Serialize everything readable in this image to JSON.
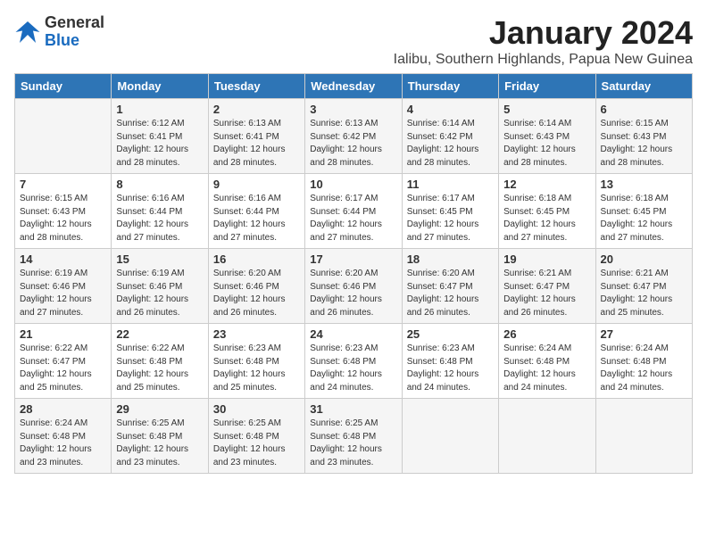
{
  "logo": {
    "general": "General",
    "blue": "Blue"
  },
  "title": "January 2024",
  "subtitle": "Ialibu, Southern Highlands, Papua New Guinea",
  "days": [
    "Sunday",
    "Monday",
    "Tuesday",
    "Wednesday",
    "Thursday",
    "Friday",
    "Saturday"
  ],
  "weeks": [
    [
      {
        "num": "",
        "info": ""
      },
      {
        "num": "1",
        "info": "Sunrise: 6:12 AM\nSunset: 6:41 PM\nDaylight: 12 hours\nand 28 minutes."
      },
      {
        "num": "2",
        "info": "Sunrise: 6:13 AM\nSunset: 6:41 PM\nDaylight: 12 hours\nand 28 minutes."
      },
      {
        "num": "3",
        "info": "Sunrise: 6:13 AM\nSunset: 6:42 PM\nDaylight: 12 hours\nand 28 minutes."
      },
      {
        "num": "4",
        "info": "Sunrise: 6:14 AM\nSunset: 6:42 PM\nDaylight: 12 hours\nand 28 minutes."
      },
      {
        "num": "5",
        "info": "Sunrise: 6:14 AM\nSunset: 6:43 PM\nDaylight: 12 hours\nand 28 minutes."
      },
      {
        "num": "6",
        "info": "Sunrise: 6:15 AM\nSunset: 6:43 PM\nDaylight: 12 hours\nand 28 minutes."
      }
    ],
    [
      {
        "num": "7",
        "info": "Sunrise: 6:15 AM\nSunset: 6:43 PM\nDaylight: 12 hours\nand 28 minutes."
      },
      {
        "num": "8",
        "info": "Sunrise: 6:16 AM\nSunset: 6:44 PM\nDaylight: 12 hours\nand 27 minutes."
      },
      {
        "num": "9",
        "info": "Sunrise: 6:16 AM\nSunset: 6:44 PM\nDaylight: 12 hours\nand 27 minutes."
      },
      {
        "num": "10",
        "info": "Sunrise: 6:17 AM\nSunset: 6:44 PM\nDaylight: 12 hours\nand 27 minutes."
      },
      {
        "num": "11",
        "info": "Sunrise: 6:17 AM\nSunset: 6:45 PM\nDaylight: 12 hours\nand 27 minutes."
      },
      {
        "num": "12",
        "info": "Sunrise: 6:18 AM\nSunset: 6:45 PM\nDaylight: 12 hours\nand 27 minutes."
      },
      {
        "num": "13",
        "info": "Sunrise: 6:18 AM\nSunset: 6:45 PM\nDaylight: 12 hours\nand 27 minutes."
      }
    ],
    [
      {
        "num": "14",
        "info": "Sunrise: 6:19 AM\nSunset: 6:46 PM\nDaylight: 12 hours\nand 27 minutes."
      },
      {
        "num": "15",
        "info": "Sunrise: 6:19 AM\nSunset: 6:46 PM\nDaylight: 12 hours\nand 26 minutes."
      },
      {
        "num": "16",
        "info": "Sunrise: 6:20 AM\nSunset: 6:46 PM\nDaylight: 12 hours\nand 26 minutes."
      },
      {
        "num": "17",
        "info": "Sunrise: 6:20 AM\nSunset: 6:46 PM\nDaylight: 12 hours\nand 26 minutes."
      },
      {
        "num": "18",
        "info": "Sunrise: 6:20 AM\nSunset: 6:47 PM\nDaylight: 12 hours\nand 26 minutes."
      },
      {
        "num": "19",
        "info": "Sunrise: 6:21 AM\nSunset: 6:47 PM\nDaylight: 12 hours\nand 26 minutes."
      },
      {
        "num": "20",
        "info": "Sunrise: 6:21 AM\nSunset: 6:47 PM\nDaylight: 12 hours\nand 25 minutes."
      }
    ],
    [
      {
        "num": "21",
        "info": "Sunrise: 6:22 AM\nSunset: 6:47 PM\nDaylight: 12 hours\nand 25 minutes."
      },
      {
        "num": "22",
        "info": "Sunrise: 6:22 AM\nSunset: 6:48 PM\nDaylight: 12 hours\nand 25 minutes."
      },
      {
        "num": "23",
        "info": "Sunrise: 6:23 AM\nSunset: 6:48 PM\nDaylight: 12 hours\nand 25 minutes."
      },
      {
        "num": "24",
        "info": "Sunrise: 6:23 AM\nSunset: 6:48 PM\nDaylight: 12 hours\nand 24 minutes."
      },
      {
        "num": "25",
        "info": "Sunrise: 6:23 AM\nSunset: 6:48 PM\nDaylight: 12 hours\nand 24 minutes."
      },
      {
        "num": "26",
        "info": "Sunrise: 6:24 AM\nSunset: 6:48 PM\nDaylight: 12 hours\nand 24 minutes."
      },
      {
        "num": "27",
        "info": "Sunrise: 6:24 AM\nSunset: 6:48 PM\nDaylight: 12 hours\nand 24 minutes."
      }
    ],
    [
      {
        "num": "28",
        "info": "Sunrise: 6:24 AM\nSunset: 6:48 PM\nDaylight: 12 hours\nand 23 minutes."
      },
      {
        "num": "29",
        "info": "Sunrise: 6:25 AM\nSunset: 6:48 PM\nDaylight: 12 hours\nand 23 minutes."
      },
      {
        "num": "30",
        "info": "Sunrise: 6:25 AM\nSunset: 6:48 PM\nDaylight: 12 hours\nand 23 minutes."
      },
      {
        "num": "31",
        "info": "Sunrise: 6:25 AM\nSunset: 6:48 PM\nDaylight: 12 hours\nand 23 minutes."
      },
      {
        "num": "",
        "info": ""
      },
      {
        "num": "",
        "info": ""
      },
      {
        "num": "",
        "info": ""
      }
    ]
  ]
}
